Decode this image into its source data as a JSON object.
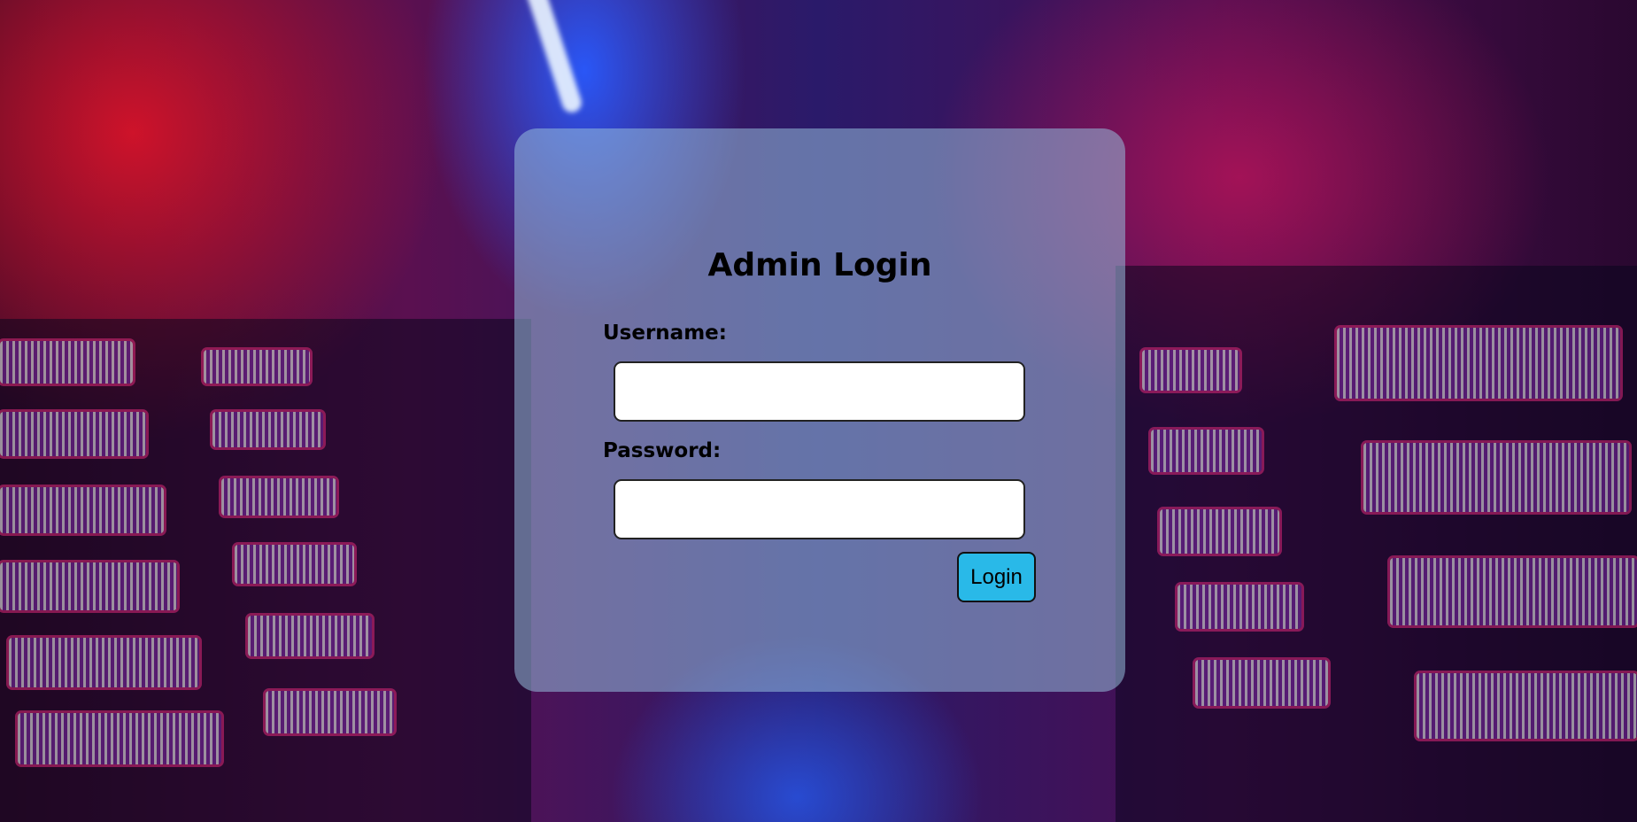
{
  "login": {
    "title": "Admin Login",
    "username_label": "Username:",
    "username_value": "",
    "password_label": "Password:",
    "password_value": "",
    "submit_label": "Login"
  },
  "theme": {
    "button_color": "#29b9e8",
    "card_color": "#96bedc"
  }
}
